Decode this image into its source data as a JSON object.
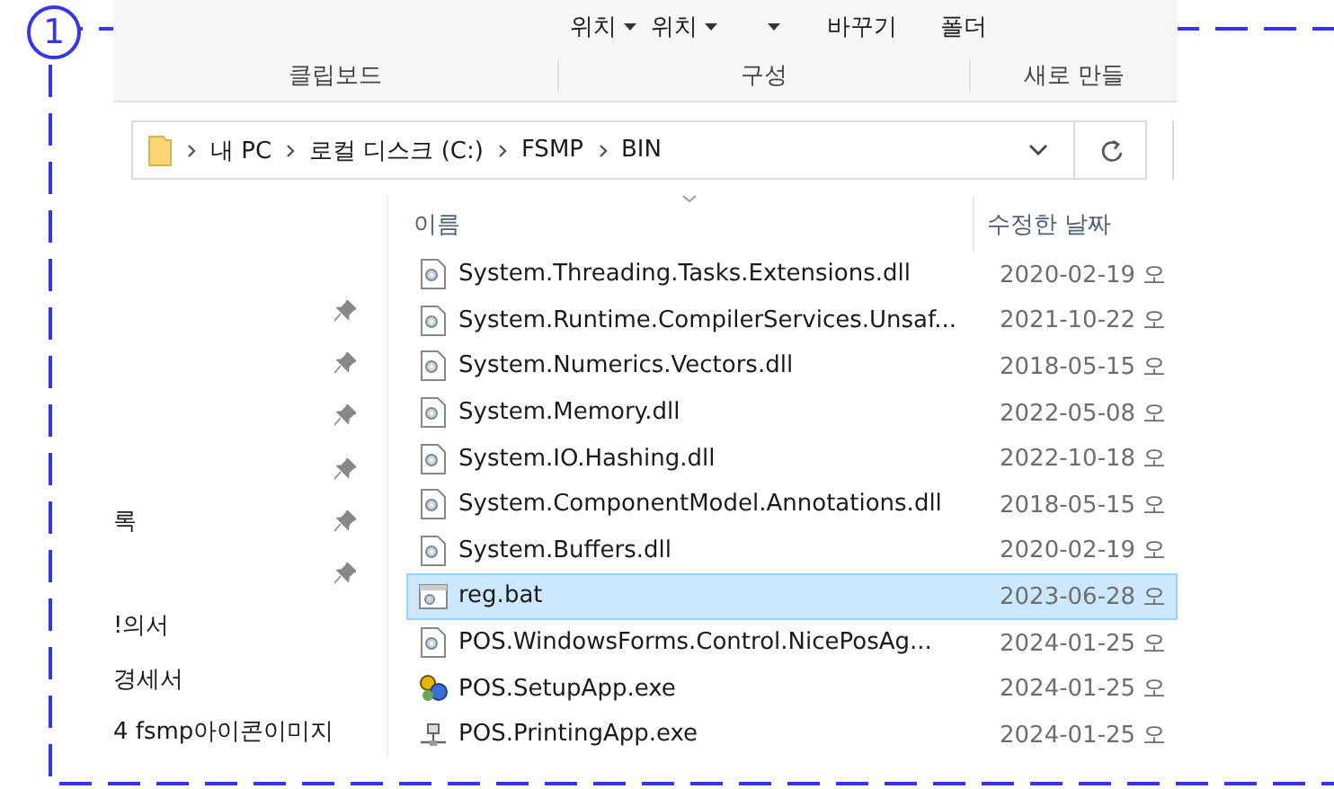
{
  "annotation": {
    "number": "1"
  },
  "ribbon": {
    "commands": [
      {
        "label": "위치",
        "kind": "dropdown"
      },
      {
        "label": "위치",
        "kind": "dropdown"
      },
      {
        "kind": "dropdown"
      },
      {
        "label": "바꾸기",
        "kind": "plain"
      },
      {
        "label": "폴더",
        "kind": "plain"
      }
    ],
    "groups": [
      {
        "label": "클립보드"
      },
      {
        "label": "구성"
      },
      {
        "label": "새로 만들"
      }
    ]
  },
  "address_bar": {
    "crumbs": [
      "내 PC",
      "로컬 디스크 (C:)",
      "FSMP",
      "BIN"
    ]
  },
  "sidebar": {
    "items": [
      {
        "pinned": true
      },
      {
        "pinned": true
      },
      {
        "pinned": true
      },
      {
        "pinned": true
      },
      {
        "label": "록",
        "pinned": true
      },
      {
        "pinned": true
      },
      {
        "label": "!의서",
        "pinned": false
      },
      {
        "label": "경세서",
        "pinned": false
      },
      {
        "label": "4 fsmp아이콘이미지",
        "pinned": false
      }
    ]
  },
  "file_list": {
    "columns": [
      "이름",
      "수정한 날짜"
    ],
    "rows": [
      {
        "name": "System.Threading.Tasks.Extensions.dll",
        "date": "2020-02-19 오",
        "kind": "dll",
        "selected": false
      },
      {
        "name": "System.Runtime.CompilerServices.Unsaf...",
        "date": "2021-10-22 오",
        "kind": "dll",
        "selected": false
      },
      {
        "name": "System.Numerics.Vectors.dll",
        "date": "2018-05-15 오",
        "kind": "dll",
        "selected": false
      },
      {
        "name": "System.Memory.dll",
        "date": "2022-05-08 오",
        "kind": "dll",
        "selected": false
      },
      {
        "name": "System.IO.Hashing.dll",
        "date": "2022-10-18 오",
        "kind": "dll",
        "selected": false
      },
      {
        "name": "System.ComponentModel.Annotations.dll",
        "date": "2018-05-15 오",
        "kind": "dll",
        "selected": false
      },
      {
        "name": "System.Buffers.dll",
        "date": "2020-02-19 오",
        "kind": "dll",
        "selected": false
      },
      {
        "name": "reg.bat",
        "date": "2023-06-28 오",
        "kind": "bat",
        "selected": true
      },
      {
        "name": "POS.WindowsForms.Control.NicePosAg...",
        "date": "2024-01-25 오",
        "kind": "dll",
        "selected": false
      },
      {
        "name": "POS.SetupApp.exe",
        "date": "2024-01-25 오",
        "kind": "setup",
        "selected": false
      },
      {
        "name": "POS.PrintingApp.exe",
        "date": "2024-01-25 오",
        "kind": "printing",
        "selected": false
      }
    ]
  }
}
